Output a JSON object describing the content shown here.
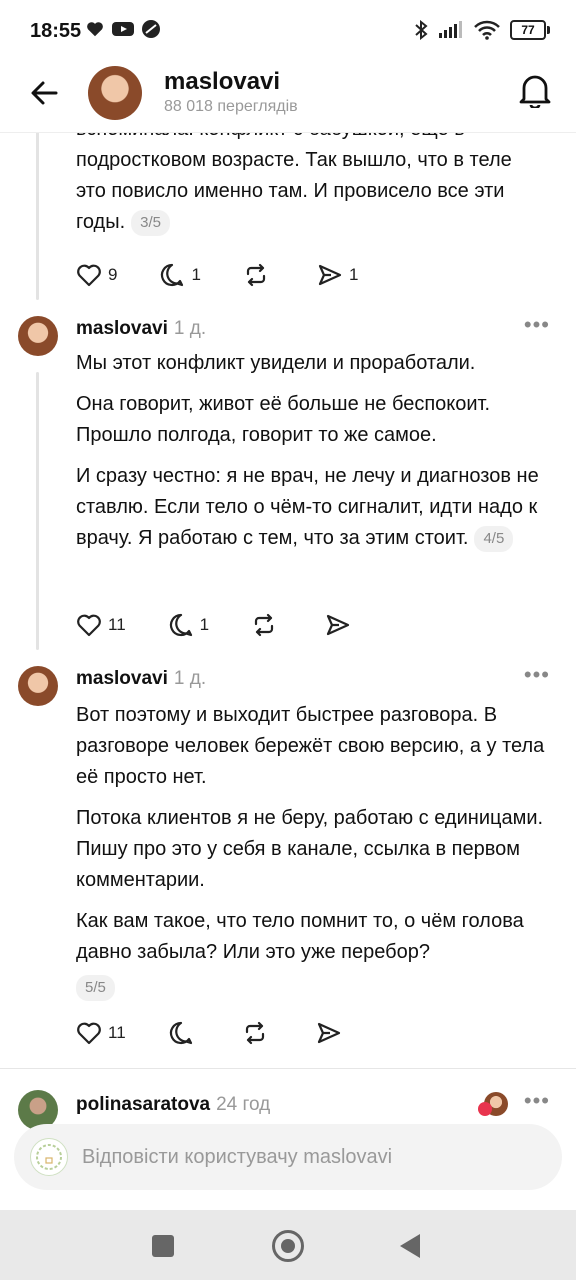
{
  "status_bar": {
    "time": "18:55",
    "battery": "77"
  },
  "header": {
    "username": "maslovavi",
    "views": "88 018 переглядів"
  },
  "posts": [
    {
      "paragraphs": [
        "вспоминала: конфликт с бабушкой, еще в подростковом возрасте. Так вышло, что в теле это повисло именно там. И провисело все эти годы."
      ],
      "pager": "3/5",
      "likes": "9",
      "comments": "1",
      "reposts": "",
      "shares": "1"
    },
    {
      "username": "maslovavi",
      "time": "1 д.",
      "paragraphs": [
        "Мы этот конфликт увидели и проработали.",
        "Она говорит, живот её больше не беспокоит. Прошло полгода, говорит то же самое.",
        "И сразу честно: я не врач, не лечу и диагнозов не ставлю. Если тело о чём-то сигналит, идти надо к врачу. Я работаю с тем, что за этим стоит."
      ],
      "pager": "4/5",
      "likes": "11",
      "comments": "1",
      "reposts": "",
      "shares": ""
    },
    {
      "username": "maslovavi",
      "time": "1 д.",
      "paragraphs": [
        "Вот поэтому и выходит быстрее разговора. В разговоре человек бережёт свою версию, а у тела её просто нет.",
        "Потока клиентов я не беру, работаю с единицами. Пишу про это у себя в канале, ссылка в первом комментарии.",
        "Как вам такое, что тело помнит то, о чём голова давно забыла? Или это уже перебор?"
      ],
      "pager": "5/5",
      "likes": "11",
      "comments": "",
      "reposts": "",
      "shares": ""
    },
    {
      "username": "polinasaratova",
      "time": "24 год"
    }
  ],
  "reply": {
    "placeholder": "Відповісти користувачу maslovavi"
  }
}
